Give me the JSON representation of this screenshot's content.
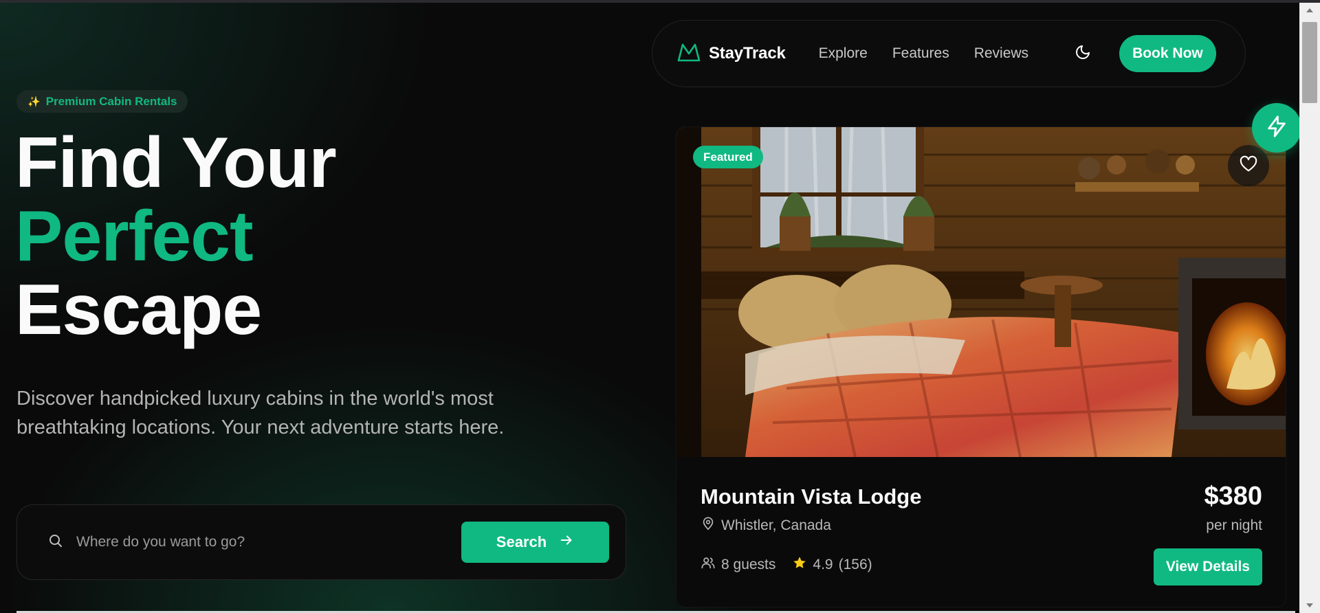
{
  "brand": {
    "name": "StayTrack",
    "accent": "#10b981"
  },
  "nav": {
    "links": [
      "Explore",
      "Features",
      "Reviews"
    ],
    "cta": "Book Now",
    "theme_icon": "moon-icon"
  },
  "hero": {
    "badge": "Premium Cabin Rentals",
    "badge_icon": "✨",
    "headline": {
      "line1": "Find Your",
      "line2": "Perfect",
      "line3": "Escape"
    },
    "subtitle": "Discover handpicked luxury cabins in the world's most breathtaking locations. Your next adventure starts here."
  },
  "search": {
    "placeholder": "Where do you want to go?",
    "button": "Search"
  },
  "card": {
    "badge": "Featured",
    "title": "Mountain Vista Lodge",
    "location": "Whistler, Canada",
    "price": "$380",
    "price_unit": "per night",
    "guests": "8 guests",
    "rating": "4.9",
    "reviews": "(156)",
    "button": "View Details"
  }
}
